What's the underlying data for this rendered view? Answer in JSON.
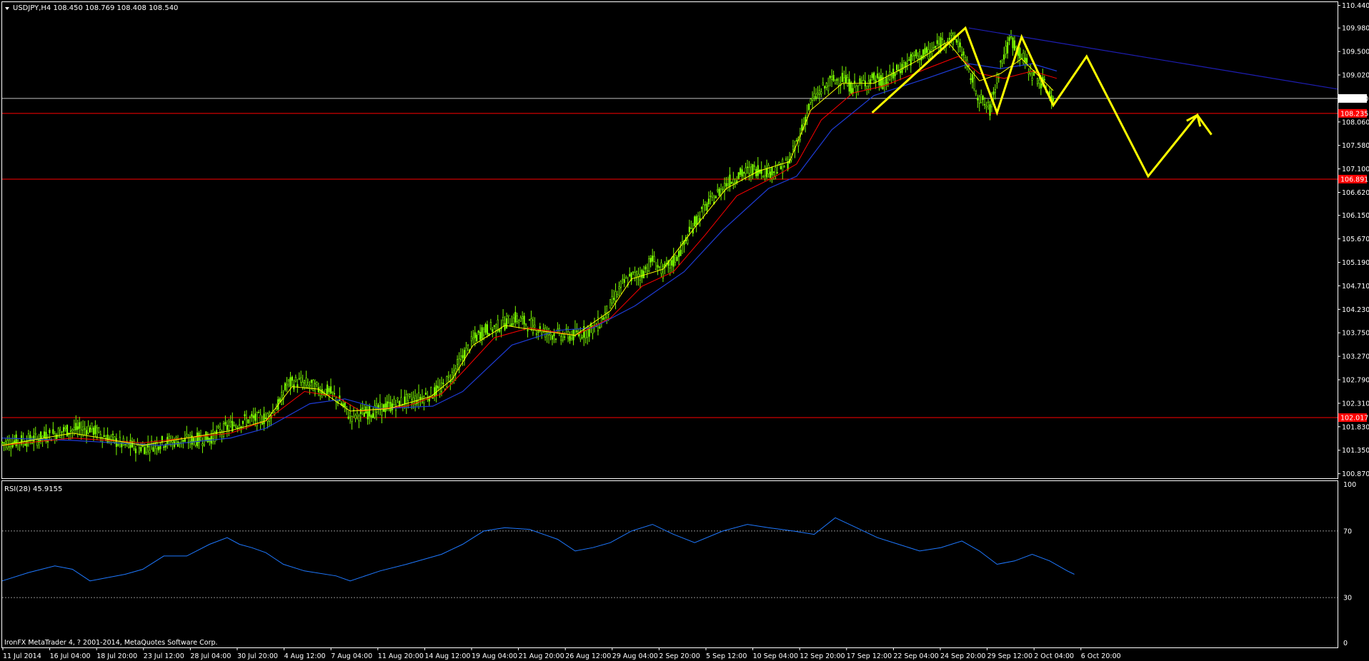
{
  "header": {
    "symbol_line": "USDJPY,H4  108.450 108.769 108.408 108.540",
    "dropdown_icon": "triangle-down-icon"
  },
  "indicator": {
    "label": "RSI(28) 45.9155"
  },
  "copyright": "IronFX MetaTrader 4, ? 2001-2014, MetaQuotes Software Corp.",
  "colors": {
    "background": "#000000",
    "grid_frame": "#ffffff",
    "bull_candle": "#7cfc00",
    "ma_fast": "#ffff00",
    "ma_mid": "#ff0000",
    "ma_slow": "#1e3cd8",
    "hline": "#ff0000",
    "current_line": "#c0c0c0",
    "trendline": "#1e1eb4",
    "projection": "#ffff00",
    "rsi": "#1e78ff"
  },
  "chart_data": {
    "type": "candlestick",
    "symbol": "USDJPY",
    "timeframe": "H4",
    "ohlc_current": {
      "open": 108.45,
      "high": 108.769,
      "low": 108.408,
      "close": 108.54
    },
    "price_axis_ticks": [
      "110.440",
      "109.980",
      "109.500",
      "109.020",
      "108.060",
      "107.580",
      "107.100",
      "106.620",
      "106.150",
      "105.670",
      "105.190",
      "104.710",
      "104.230",
      "103.750",
      "103.270",
      "102.790",
      "102.310",
      "101.830",
      "101.350",
      "100.870"
    ],
    "price_range": [
      100.85,
      110.45
    ],
    "current_price_label": "108.540",
    "horizontal_levels": [
      {
        "label": "108.235",
        "price": 108.235
      },
      {
        "label": "106.891",
        "price": 106.891
      },
      {
        "label": "102.017",
        "price": 102.017
      }
    ],
    "time_axis_labels": [
      "11 Jul 2014",
      "16 Jul 04:00",
      "18 Jul 20:00",
      "23 Jul 12:00",
      "28 Jul 04:00",
      "30 Jul 20:00",
      "4 Aug 12:00",
      "7 Aug 04:00",
      "11 Aug 20:00",
      "14 Aug 12:00",
      "19 Aug 04:00",
      "21 Aug 20:00",
      "26 Aug 12:00",
      "29 Aug 04:00",
      "2 Sep 20:00",
      "5 Sep 12:00",
      "10 Sep 04:00",
      "12 Sep 20:00",
      "17 Sep 12:00",
      "22 Sep 04:00",
      "24 Sep 20:00",
      "29 Sep 12:00",
      "2 Oct 04:00",
      "6 Oct 20:00"
    ],
    "close_path": [
      [
        0,
        101.5
      ],
      [
        20,
        101.58
      ],
      [
        35,
        101.75
      ],
      [
        50,
        101.8
      ],
      [
        60,
        101.6
      ],
      [
        70,
        101.45
      ],
      [
        80,
        101.4
      ],
      [
        92,
        101.52
      ],
      [
        105,
        101.55
      ],
      [
        118,
        101.6
      ],
      [
        130,
        101.85
      ],
      [
        140,
        101.98
      ],
      [
        150,
        102.0
      ],
      [
        158,
        102.3
      ],
      [
        162,
        102.7
      ],
      [
        168,
        102.75
      ],
      [
        174,
        102.7
      ],
      [
        180,
        102.6
      ],
      [
        186,
        102.55
      ],
      [
        192,
        102.35
      ],
      [
        198,
        102.05
      ],
      [
        204,
        102.1
      ],
      [
        212,
        102.15
      ],
      [
        220,
        102.25
      ],
      [
        228,
        102.35
      ],
      [
        236,
        102.4
      ],
      [
        244,
        102.5
      ],
      [
        250,
        102.6
      ],
      [
        256,
        102.9
      ],
      [
        262,
        103.25
      ],
      [
        268,
        103.6
      ],
      [
        274,
        103.8
      ],
      [
        280,
        103.85
      ],
      [
        286,
        103.95
      ],
      [
        292,
        104.05
      ],
      [
        298,
        103.95
      ],
      [
        304,
        103.85
      ],
      [
        310,
        103.75
      ],
      [
        318,
        103.7
      ],
      [
        326,
        103.7
      ],
      [
        334,
        103.8
      ],
      [
        340,
        103.95
      ],
      [
        346,
        104.3
      ],
      [
        352,
        104.7
      ],
      [
        358,
        104.9
      ],
      [
        364,
        104.95
      ],
      [
        370,
        105.25
      ],
      [
        376,
        105.0
      ],
      [
        382,
        105.2
      ],
      [
        388,
        105.55
      ],
      [
        394,
        106.0
      ],
      [
        400,
        106.3
      ],
      [
        406,
        106.55
      ],
      [
        412,
        106.8
      ],
      [
        418,
        106.95
      ],
      [
        424,
        107.05
      ],
      [
        430,
        107.1
      ],
      [
        436,
        107.05
      ],
      [
        442,
        107.1
      ],
      [
        448,
        107.25
      ],
      [
        454,
        107.8
      ],
      [
        460,
        108.45
      ],
      [
        466,
        108.7
      ],
      [
        472,
        108.9
      ],
      [
        478,
        108.95
      ],
      [
        484,
        108.75
      ],
      [
        490,
        108.85
      ],
      [
        496,
        108.95
      ],
      [
        502,
        108.85
      ],
      [
        508,
        109.05
      ],
      [
        514,
        109.25
      ],
      [
        520,
        109.4
      ],
      [
        526,
        109.45
      ],
      [
        532,
        109.6
      ],
      [
        538,
        109.8
      ],
      [
        544,
        109.7
      ],
      [
        550,
        109.1
      ],
      [
        556,
        108.55
      ],
      [
        562,
        108.3
      ],
      [
        568,
        109.25
      ],
      [
        574,
        109.75
      ],
      [
        580,
        109.4
      ],
      [
        586,
        109.05
      ],
      [
        592,
        108.85
      ],
      [
        598,
        108.54
      ]
    ],
    "ma_fast": [
      [
        0,
        101.45
      ],
      [
        40,
        101.7
      ],
      [
        80,
        101.45
      ],
      [
        130,
        101.75
      ],
      [
        150,
        101.95
      ],
      [
        165,
        102.65
      ],
      [
        180,
        102.6
      ],
      [
        198,
        102.15
      ],
      [
        220,
        102.2
      ],
      [
        244,
        102.45
      ],
      [
        256,
        102.8
      ],
      [
        268,
        103.5
      ],
      [
        286,
        103.9
      ],
      [
        304,
        103.8
      ],
      [
        326,
        103.7
      ],
      [
        346,
        104.2
      ],
      [
        358,
        104.85
      ],
      [
        376,
        105.05
      ],
      [
        394,
        105.9
      ],
      [
        412,
        106.7
      ],
      [
        430,
        107.05
      ],
      [
        448,
        107.25
      ],
      [
        460,
        108.3
      ],
      [
        478,
        108.85
      ],
      [
        496,
        108.85
      ],
      [
        520,
        109.3
      ],
      [
        538,
        109.7
      ],
      [
        556,
        108.9
      ],
      [
        568,
        109.05
      ],
      [
        580,
        109.35
      ],
      [
        598,
        108.7
      ]
    ],
    "ma_mid": [
      [
        0,
        101.45
      ],
      [
        40,
        101.6
      ],
      [
        80,
        101.5
      ],
      [
        130,
        101.7
      ],
      [
        150,
        101.95
      ],
      [
        172,
        102.55
      ],
      [
        190,
        102.45
      ],
      [
        204,
        102.15
      ],
      [
        230,
        102.25
      ],
      [
        250,
        102.5
      ],
      [
        262,
        102.95
      ],
      [
        280,
        103.65
      ],
      [
        300,
        103.85
      ],
      [
        326,
        103.7
      ],
      [
        346,
        104.05
      ],
      [
        364,
        104.7
      ],
      [
        382,
        105.0
      ],
      [
        400,
        105.75
      ],
      [
        418,
        106.55
      ],
      [
        440,
        106.95
      ],
      [
        452,
        107.2
      ],
      [
        466,
        108.1
      ],
      [
        484,
        108.65
      ],
      [
        502,
        108.8
      ],
      [
        526,
        109.15
      ],
      [
        544,
        109.4
      ],
      [
        556,
        109.05
      ],
      [
        570,
        108.95
      ],
      [
        586,
        109.1
      ],
      [
        600,
        108.95
      ]
    ],
    "ma_slow": [
      [
        0,
        101.6
      ],
      [
        40,
        101.55
      ],
      [
        90,
        101.45
      ],
      [
        130,
        101.6
      ],
      [
        150,
        101.8
      ],
      [
        175,
        102.3
      ],
      [
        195,
        102.4
      ],
      [
        215,
        102.2
      ],
      [
        245,
        102.25
      ],
      [
        262,
        102.55
      ],
      [
        290,
        103.5
      ],
      [
        316,
        103.8
      ],
      [
        336,
        103.85
      ],
      [
        360,
        104.3
      ],
      [
        388,
        105.0
      ],
      [
        410,
        105.85
      ],
      [
        436,
        106.7
      ],
      [
        452,
        106.95
      ],
      [
        472,
        107.9
      ],
      [
        496,
        108.6
      ],
      [
        526,
        108.95
      ],
      [
        550,
        109.25
      ],
      [
        568,
        109.15
      ],
      [
        586,
        109.25
      ],
      [
        600,
        109.1
      ]
    ],
    "trendline": [
      [
        550,
        109.98
      ],
      [
        765,
        108.7
      ]
    ],
    "projection_zigzag": [
      [
        495,
        108.25
      ],
      [
        548,
        109.98
      ],
      [
        566,
        108.25
      ],
      [
        580,
        109.8
      ],
      [
        598,
        108.4
      ],
      [
        617,
        109.4
      ],
      [
        652,
        106.95
      ],
      [
        680,
        108.2
      ],
      [
        688,
        107.8
      ]
    ],
    "rsi": {
      "period": 28,
      "value": 45.9155,
      "levels": [
        70,
        30
      ],
      "axis_ticks": [
        "100",
        "70",
        "30",
        "0"
      ],
      "series": [
        [
          0,
          40
        ],
        [
          15,
          45
        ],
        [
          30,
          49
        ],
        [
          40,
          47
        ],
        [
          50,
          40
        ],
        [
          60,
          42
        ],
        [
          70,
          44
        ],
        [
          80,
          47
        ],
        [
          92,
          55
        ],
        [
          105,
          55
        ],
        [
          118,
          62
        ],
        [
          128,
          66
        ],
        [
          135,
          62
        ],
        [
          142,
          60
        ],
        [
          150,
          57
        ],
        [
          160,
          50
        ],
        [
          172,
          46
        ],
        [
          190,
          43
        ],
        [
          198,
          40
        ],
        [
          215,
          46
        ],
        [
          230,
          50
        ],
        [
          250,
          56
        ],
        [
          262,
          62
        ],
        [
          274,
          70
        ],
        [
          286,
          72
        ],
        [
          300,
          71
        ],
        [
          316,
          65
        ],
        [
          326,
          58
        ],
        [
          336,
          60
        ],
        [
          346,
          63
        ],
        [
          358,
          70
        ],
        [
          370,
          74
        ],
        [
          382,
          68
        ],
        [
          394,
          63
        ],
        [
          410,
          70
        ],
        [
          424,
          74
        ],
        [
          436,
          72
        ],
        [
          450,
          70
        ],
        [
          462,
          68
        ],
        [
          474,
          78
        ],
        [
          486,
          72
        ],
        [
          498,
          66
        ],
        [
          510,
          62
        ],
        [
          522,
          58
        ],
        [
          534,
          60
        ],
        [
          546,
          64
        ],
        [
          556,
          58
        ],
        [
          566,
          50
        ],
        [
          576,
          52
        ],
        [
          586,
          56
        ],
        [
          596,
          52
        ],
        [
          606,
          46
        ],
        [
          610,
          44
        ]
      ]
    }
  }
}
